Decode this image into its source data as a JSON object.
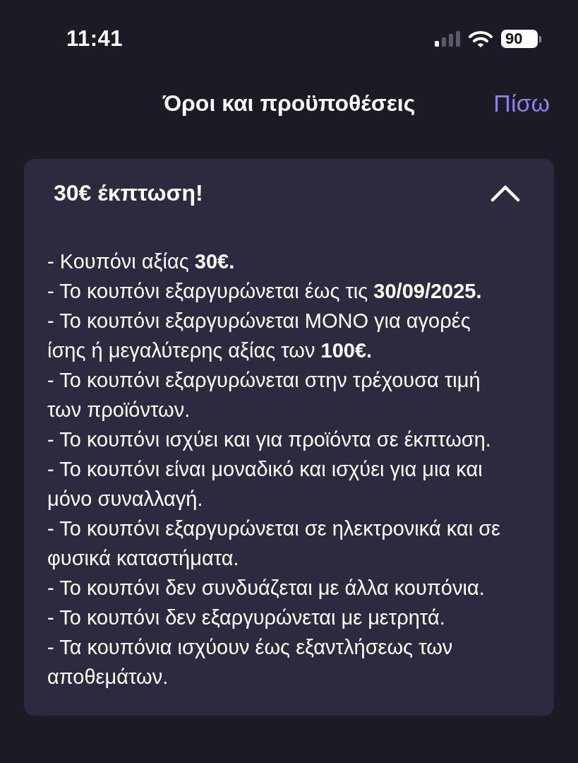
{
  "status_bar": {
    "time": "11:41",
    "battery": "90"
  },
  "header": {
    "title": "Όροι και προϋποθέσεις",
    "back": "Πίσω"
  },
  "accordion": {
    "title": "30€ έκπτωση!",
    "expanded": true,
    "terms": [
      "- Κουπόνι αξίας **30€.**",
      "- Το κουπόνι εξαργυρώνεται έως τις **30/09/2025.**",
      "- Το κουπόνι εξαργυρώνεται ΜΟΝΟ για αγορές ίσης ή μεγαλύτερης αξίας των **100€.**",
      "- Το κουπόνι εξαργυρώνεται στην τρέχουσα τιμή των προϊόντων.",
      "- Το κουπόνι ισχύει και για προϊόντα σε έκπτωση.",
      "- Το κουπόνι είναι μοναδικό και ισχύει για μια και μόνο συναλλαγή.",
      "- Το κουπόνι εξαργυρώνεται σε ηλεκτρονικά και σε φυσικά καταστήματα.",
      "- Το κουπόνι δεν συνδυάζεται με άλλα κουπόνια.",
      "- Το κουπόνι δεν εξαργυρώνεται με μετρητά.",
      "- Τα κουπόνια ισχύουν έως εξαντλήσεως των αποθεμάτων."
    ]
  }
}
